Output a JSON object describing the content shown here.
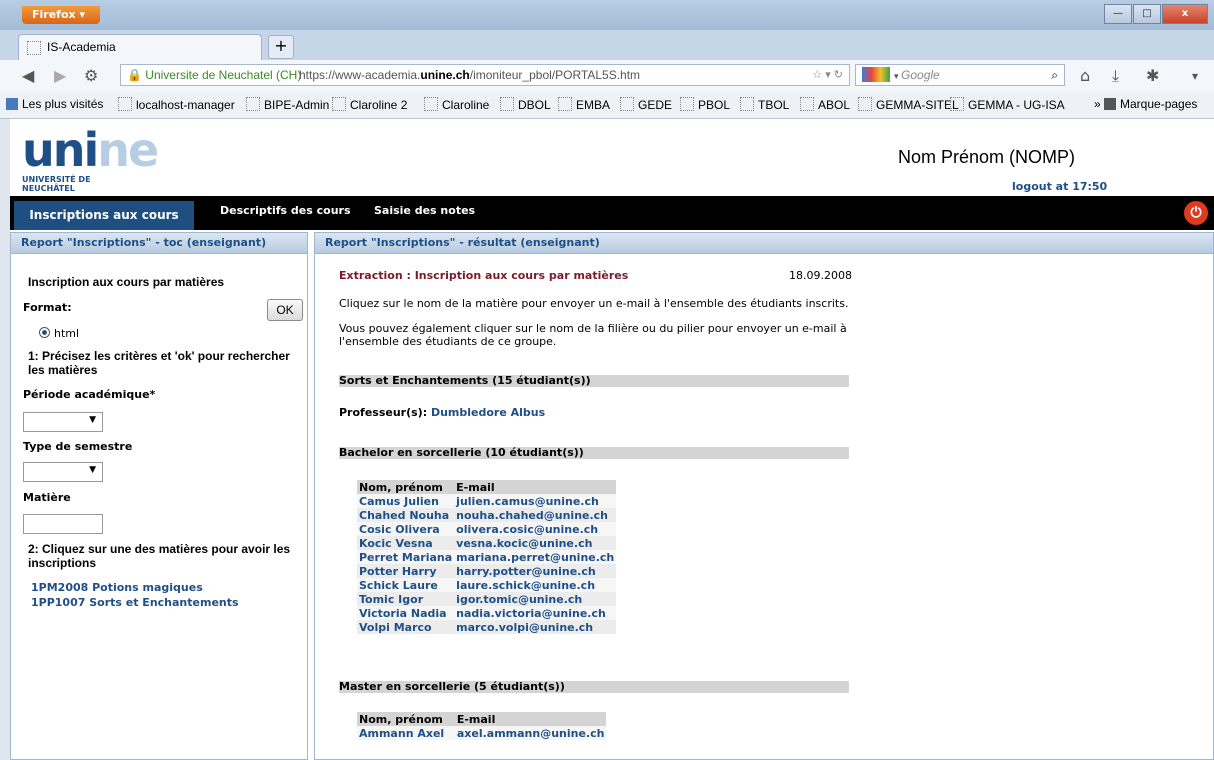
{
  "browser": {
    "app_button": "Firefox",
    "tab_title": "IS-Academia",
    "site_identity": "Universite de Neuchatel (CH)",
    "url_prefix": "https://www-academia.",
    "url_domain": "unine.ch",
    "url_path": "/imoniteur_pbol/PORTAL5S.htm",
    "search_placeholder": "Google",
    "bookmarks": [
      "Les plus visités",
      "localhost-manager",
      "BIPE-Admin",
      "Claroline 2",
      "Claroline",
      "DBOL",
      "EMBA",
      "GEDE",
      "PBOL",
      "TBOL",
      "ABOL",
      "GEMMA-SITEL",
      "GEMMA - UG-ISA"
    ],
    "bookmarks_menu": "Marque-pages"
  },
  "header": {
    "logo_sub_line1": "UNIVERSITÉ DE",
    "logo_sub_line2": "NEUCHÂTEL",
    "user_name": "Nom Prénom (NOMP)",
    "logout": "logout at 17:50"
  },
  "menu": {
    "items": [
      "Inscriptions aux cours",
      "Descriptifs des cours",
      "Saisie des notes"
    ]
  },
  "left_panel": {
    "header": "Report \"Inscriptions\" - toc (enseignant)",
    "title": "Inscription aux cours par matières",
    "format_label": "Format:",
    "ok_label": "OK",
    "radio_html": "html",
    "step1": "1: Précisez les critères et 'ok' pour rechercher les matières",
    "periode_label": "Période académique*",
    "type_label": "Type de semestre",
    "matiere_label": "Matière",
    "step2": "2: Cliquez sur une des matières pour avoir les inscriptions",
    "matieres": [
      "1PM2008 Potions magiques",
      "1PP1007 Sorts et Enchantements"
    ]
  },
  "right_panel": {
    "header": "Report \"Inscriptions\" - résultat (enseignant)",
    "extraction_title": "Extraction : Inscription aux cours par matières",
    "date": "18.09.2008",
    "para1": "Cliquez sur le nom de la matière pour envoyer un e-mail à l'ensemble des étudiants inscrits.",
    "para2_line1": "Vous pouvez également cliquer sur le nom de la filière ou du pilier pour envoyer un e-mail à",
    "para2_line2": "l'ensemble des étudiants de ce groupe.",
    "course_header": "Sorts et Enchantements  (15 étudiant(s))",
    "prof_label": "Professeur(s):",
    "prof_name": "Dumbledore Albus",
    "group1_header": "Bachelor en sorcellerie (10 étudiant(s))",
    "col_name": "Nom, prénom",
    "col_email": "E-mail",
    "group1_students": [
      {
        "name": "Camus Julien",
        "email": "julien.camus@unine.ch"
      },
      {
        "name": "Chahed Nouha",
        "email": "nouha.chahed@unine.ch"
      },
      {
        "name": "Cosic Olivera",
        "email": "olivera.cosic@unine.ch"
      },
      {
        "name": "Kocic Vesna",
        "email": "vesna.kocic@unine.ch"
      },
      {
        "name": "Perret Mariana",
        "email": "mariana.perret@unine.ch"
      },
      {
        "name": "Potter Harry",
        "email": "harry.potter@unine.ch"
      },
      {
        "name": "Schick Laure",
        "email": "laure.schick@unine.ch"
      },
      {
        "name": "Tomic Igor",
        "email": "igor.tomic@unine.ch"
      },
      {
        "name": "Victoria Nadia",
        "email": "nadia.victoria@unine.ch"
      },
      {
        "name": "Volpi Marco",
        "email": "marco.volpi@unine.ch"
      }
    ],
    "group2_header": "Master en sorcellerie (5 étudiant(s))",
    "group2_students": [
      {
        "name": "Ammann Axel",
        "email": "axel.ammann@unine.ch"
      }
    ]
  }
}
